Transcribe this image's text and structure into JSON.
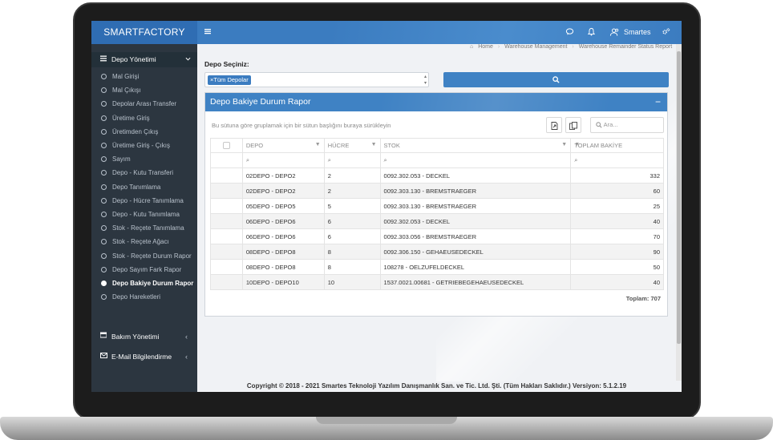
{
  "header": {
    "brand": "SMARTFACTORY",
    "menu_icon": "hamburger-icon",
    "chat_icon": "chat-icon",
    "bell_icon": "bell-icon",
    "user_icon": "users-icon",
    "user_name": "Smartes",
    "settings_icon": "gears-icon"
  },
  "sidebar": {
    "section_title": "Depo Yönetimi",
    "items": [
      "Mal Girişi",
      "Mal Çıkışı",
      "Depolar Arası Transfer",
      "Üretime Giriş",
      "Üretimden Çıkış",
      "Üretime Giriş - Çıkış",
      "Sayım",
      "Depo - Kutu Transferi",
      "Depo Tanımlama",
      "Depo - Hücre Tanımlama",
      "Depo - Kutu Tanımlama",
      "Stok - Reçete Tanımlama",
      "Stok - Reçete Ağacı",
      "Stok - Reçete Durum Rapor",
      "Depo Sayım Fark Rapor",
      "Depo Bakiye Durum Rapor",
      "Depo Hareketleri"
    ],
    "active_index": 15,
    "groups": [
      "Bakım Yönetimi",
      "E-Mail Bilgilendirme"
    ]
  },
  "breadcrumb": [
    "Home",
    "Warehouse Management",
    "Warehouse Remainder Status Report"
  ],
  "filter": {
    "label": "Depo Seçiniz:",
    "selected_chip": "×Tüm Depolar",
    "search_icon": "search-icon"
  },
  "panel": {
    "title": "Depo Bakiye Durum Rapor",
    "collapse": "−",
    "group_hint": "Bu sütuna göre gruplamak için bir sütun başlığını buraya sürükleyin",
    "search_placeholder": "Ara...",
    "columns": [
      "DEPO",
      "HÜCRE",
      "STOK",
      "TOPLAM BAKİYE"
    ],
    "rows": [
      [
        "02DEPO - DEPO2",
        "2",
        "0092.302.053 - DECKEL",
        "332"
      ],
      [
        "02DEPO - DEPO2",
        "2",
        "0092.303.130 - BREMSTRAEGER",
        "60"
      ],
      [
        "05DEPO - DEPO5",
        "5",
        "0092.303.130 - BREMSTRAEGER",
        "25"
      ],
      [
        "06DEPO - DEPO6",
        "6",
        "0092.302.053 - DECKEL",
        "40"
      ],
      [
        "06DEPO - DEPO6",
        "6",
        "0092.303.056 - BREMSTRAEGER",
        "70"
      ],
      [
        "08DEPO - DEPO8",
        "8",
        "0092.306.150 - GEHAEUSEDECKEL",
        "90"
      ],
      [
        "08DEPO - DEPO8",
        "8",
        "108278 - OELZUFELDECKEL",
        "50"
      ],
      [
        "10DEPO - DEPO10",
        "10",
        "1537.0021.00681 - GETRIEBEGEHAEUSEDECKEL",
        "40"
      ]
    ],
    "total": "Toplam: 707"
  },
  "footer": "Copyright © 2018 - 2021 Smartes Teknoloji Yazılım Danışmanlık San. ve Tic. Ltd. Şti. (Tüm Hakları Saklıdır.) Versiyon: 5.1.2.19"
}
